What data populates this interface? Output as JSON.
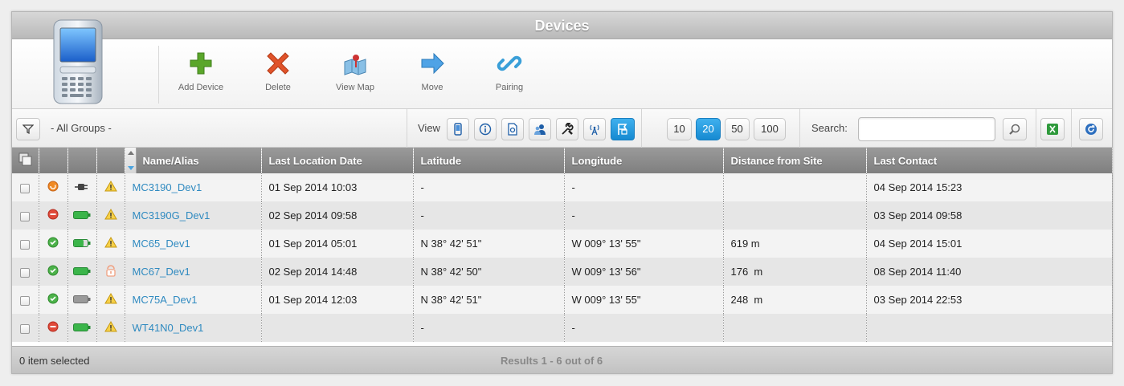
{
  "title": "Devices",
  "toolbar": {
    "buttons": [
      {
        "label": "Add Device",
        "icon": "plus-icon"
      },
      {
        "label": "Delete",
        "icon": "x-icon"
      },
      {
        "label": "View Map",
        "icon": "map-icon"
      },
      {
        "label": "Move",
        "icon": "arrow-right-icon"
      },
      {
        "label": "Pairing",
        "icon": "link-icon"
      }
    ]
  },
  "filter": {
    "group_label": "- All Groups -",
    "view_label": "View",
    "page_sizes": [
      "10",
      "20",
      "50",
      "100"
    ],
    "active_page_size": "20",
    "search_label": "Search:",
    "search_value": ""
  },
  "table": {
    "columns": [
      "Name/Alias",
      "Last Location Date",
      "Latitude",
      "Longitude",
      "Distance from Site",
      "Last Contact"
    ],
    "rows": [
      {
        "name": "MC3190_Dev1",
        "location_date": "01 Sep 2014 10:03",
        "latitude": "-",
        "longitude": "-",
        "distance": "",
        "last_contact": "04 Sep 2014 15:23",
        "status": "warning-orange",
        "power": "plug",
        "alert": "warning"
      },
      {
        "name": "MC3190G_Dev1",
        "location_date": "02 Sep 2014 09:58",
        "latitude": "-",
        "longitude": "-",
        "distance": "",
        "last_contact": "03 Sep 2014 09:58",
        "status": "stop-red",
        "power": "battery-full",
        "alert": "warning"
      },
      {
        "name": "MC65_Dev1",
        "location_date": "01 Sep 2014 05:01",
        "latitude": "N 38° 42' 51\"",
        "longitude": "W 009° 13' 55\"",
        "distance": "619 m",
        "last_contact": "04 Sep 2014 15:01",
        "status": "ok-green",
        "power": "battery-medium",
        "alert": "warning"
      },
      {
        "name": "MC67_Dev1",
        "location_date": "02 Sep 2014 14:48",
        "latitude": "N 38° 42' 50\"",
        "longitude": "W 009° 13' 56\"",
        "distance": "176  m",
        "last_contact": "08 Sep 2014 11:40",
        "status": "ok-green",
        "power": "battery-full",
        "alert": "lock"
      },
      {
        "name": "MC75A_Dev1",
        "location_date": "01 Sep 2014 12:03",
        "latitude": "N 38° 42' 51\"",
        "longitude": "W 009° 13' 55\"",
        "distance": "248  m",
        "last_contact": "03 Sep 2014 22:53",
        "status": "ok-green",
        "power": "battery-gray",
        "alert": "warning"
      },
      {
        "name": "WT41N0_Dev1",
        "location_date": "",
        "latitude": "-",
        "longitude": "-",
        "distance": "",
        "last_contact": "",
        "status": "stop-red",
        "power": "battery-full",
        "alert": "warning"
      }
    ]
  },
  "footer": {
    "selected": "0 item selected",
    "results": "Results 1 - 6 out of 6"
  }
}
